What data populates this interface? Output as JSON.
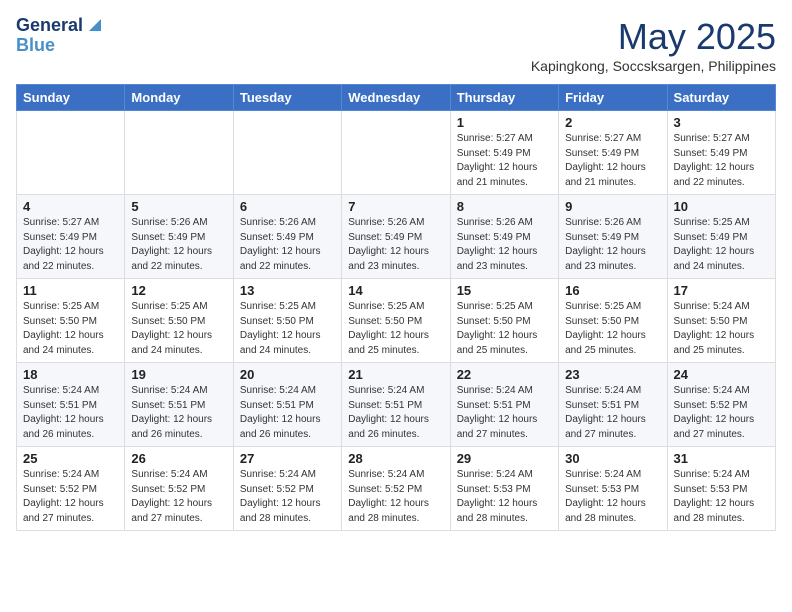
{
  "logo": {
    "line1": "General",
    "line2": "Blue"
  },
  "title": "May 2025",
  "subtitle": "Kapingkong, Soccsksargen, Philippines",
  "days_of_week": [
    "Sunday",
    "Monday",
    "Tuesday",
    "Wednesday",
    "Thursday",
    "Friday",
    "Saturday"
  ],
  "weeks": [
    [
      {
        "day": "",
        "content": ""
      },
      {
        "day": "",
        "content": ""
      },
      {
        "day": "",
        "content": ""
      },
      {
        "day": "",
        "content": ""
      },
      {
        "day": "1",
        "content": "Sunrise: 5:27 AM\nSunset: 5:49 PM\nDaylight: 12 hours\nand 21 minutes."
      },
      {
        "day": "2",
        "content": "Sunrise: 5:27 AM\nSunset: 5:49 PM\nDaylight: 12 hours\nand 21 minutes."
      },
      {
        "day": "3",
        "content": "Sunrise: 5:27 AM\nSunset: 5:49 PM\nDaylight: 12 hours\nand 22 minutes."
      }
    ],
    [
      {
        "day": "4",
        "content": "Sunrise: 5:27 AM\nSunset: 5:49 PM\nDaylight: 12 hours\nand 22 minutes."
      },
      {
        "day": "5",
        "content": "Sunrise: 5:26 AM\nSunset: 5:49 PM\nDaylight: 12 hours\nand 22 minutes."
      },
      {
        "day": "6",
        "content": "Sunrise: 5:26 AM\nSunset: 5:49 PM\nDaylight: 12 hours\nand 22 minutes."
      },
      {
        "day": "7",
        "content": "Sunrise: 5:26 AM\nSunset: 5:49 PM\nDaylight: 12 hours\nand 23 minutes."
      },
      {
        "day": "8",
        "content": "Sunrise: 5:26 AM\nSunset: 5:49 PM\nDaylight: 12 hours\nand 23 minutes."
      },
      {
        "day": "9",
        "content": "Sunrise: 5:26 AM\nSunset: 5:49 PM\nDaylight: 12 hours\nand 23 minutes."
      },
      {
        "day": "10",
        "content": "Sunrise: 5:25 AM\nSunset: 5:49 PM\nDaylight: 12 hours\nand 24 minutes."
      }
    ],
    [
      {
        "day": "11",
        "content": "Sunrise: 5:25 AM\nSunset: 5:50 PM\nDaylight: 12 hours\nand 24 minutes."
      },
      {
        "day": "12",
        "content": "Sunrise: 5:25 AM\nSunset: 5:50 PM\nDaylight: 12 hours\nand 24 minutes."
      },
      {
        "day": "13",
        "content": "Sunrise: 5:25 AM\nSunset: 5:50 PM\nDaylight: 12 hours\nand 24 minutes."
      },
      {
        "day": "14",
        "content": "Sunrise: 5:25 AM\nSunset: 5:50 PM\nDaylight: 12 hours\nand 25 minutes."
      },
      {
        "day": "15",
        "content": "Sunrise: 5:25 AM\nSunset: 5:50 PM\nDaylight: 12 hours\nand 25 minutes."
      },
      {
        "day": "16",
        "content": "Sunrise: 5:25 AM\nSunset: 5:50 PM\nDaylight: 12 hours\nand 25 minutes."
      },
      {
        "day": "17",
        "content": "Sunrise: 5:24 AM\nSunset: 5:50 PM\nDaylight: 12 hours\nand 25 minutes."
      }
    ],
    [
      {
        "day": "18",
        "content": "Sunrise: 5:24 AM\nSunset: 5:51 PM\nDaylight: 12 hours\nand 26 minutes."
      },
      {
        "day": "19",
        "content": "Sunrise: 5:24 AM\nSunset: 5:51 PM\nDaylight: 12 hours\nand 26 minutes."
      },
      {
        "day": "20",
        "content": "Sunrise: 5:24 AM\nSunset: 5:51 PM\nDaylight: 12 hours\nand 26 minutes."
      },
      {
        "day": "21",
        "content": "Sunrise: 5:24 AM\nSunset: 5:51 PM\nDaylight: 12 hours\nand 26 minutes."
      },
      {
        "day": "22",
        "content": "Sunrise: 5:24 AM\nSunset: 5:51 PM\nDaylight: 12 hours\nand 27 minutes."
      },
      {
        "day": "23",
        "content": "Sunrise: 5:24 AM\nSunset: 5:51 PM\nDaylight: 12 hours\nand 27 minutes."
      },
      {
        "day": "24",
        "content": "Sunrise: 5:24 AM\nSunset: 5:52 PM\nDaylight: 12 hours\nand 27 minutes."
      }
    ],
    [
      {
        "day": "25",
        "content": "Sunrise: 5:24 AM\nSunset: 5:52 PM\nDaylight: 12 hours\nand 27 minutes."
      },
      {
        "day": "26",
        "content": "Sunrise: 5:24 AM\nSunset: 5:52 PM\nDaylight: 12 hours\nand 27 minutes."
      },
      {
        "day": "27",
        "content": "Sunrise: 5:24 AM\nSunset: 5:52 PM\nDaylight: 12 hours\nand 28 minutes."
      },
      {
        "day": "28",
        "content": "Sunrise: 5:24 AM\nSunset: 5:52 PM\nDaylight: 12 hours\nand 28 minutes."
      },
      {
        "day": "29",
        "content": "Sunrise: 5:24 AM\nSunset: 5:53 PM\nDaylight: 12 hours\nand 28 minutes."
      },
      {
        "day": "30",
        "content": "Sunrise: 5:24 AM\nSunset: 5:53 PM\nDaylight: 12 hours\nand 28 minutes."
      },
      {
        "day": "31",
        "content": "Sunrise: 5:24 AM\nSunset: 5:53 PM\nDaylight: 12 hours\nand 28 minutes."
      }
    ]
  ]
}
